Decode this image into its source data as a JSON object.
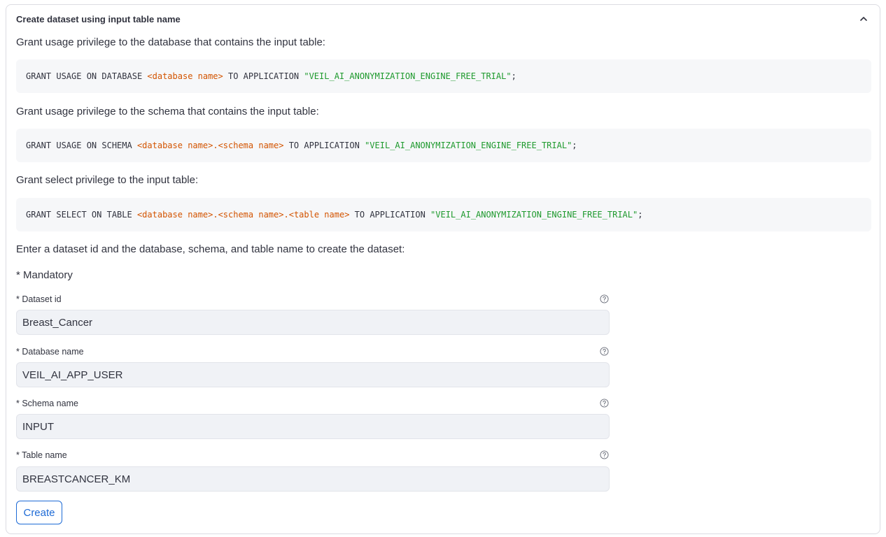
{
  "expander": {
    "title": "Create dataset using input table name"
  },
  "instructions": [
    "Grant usage privilege to the database that contains the input table:",
    "Grant usage privilege to the schema that contains the input table:",
    "Grant select privilege to the input table:",
    "Enter a dataset id and the database, schema, and table name to create the dataset:"
  ],
  "code": {
    "db": {
      "prefix": "GRANT USAGE ON DATABASE ",
      "db_placeholder": "<database name>",
      "middle": " TO APPLICATION ",
      "app": "\"VEIL_AI_ANONYMIZATION_ENGINE_FREE_TRIAL\"",
      "end": ";"
    },
    "schema": {
      "prefix": "GRANT USAGE ON SCHEMA ",
      "db_placeholder": "<database name>",
      "dot": ".",
      "schema_placeholder": "<schema name>",
      "middle": " TO APPLICATION ",
      "app": "\"VEIL_AI_ANONYMIZATION_ENGINE_FREE_TRIAL\"",
      "end": ";"
    },
    "table": {
      "prefix": "GRANT SELECT ON TABLE ",
      "db_placeholder": "<database name>",
      "dot1": ".",
      "schema_placeholder": "<schema name>",
      "dot2": ".",
      "table_placeholder": "<table name>",
      "middle": " TO APPLICATION ",
      "app": "\"VEIL_AI_ANONYMIZATION_ENGINE_FREE_TRIAL\"",
      "end": ";"
    }
  },
  "form": {
    "mandatory_note": "* Mandatory",
    "fields": [
      {
        "label": "* Dataset id",
        "value": "Breast_Cancer"
      },
      {
        "label": "* Database name",
        "value": "VEIL_AI_APP_USER"
      },
      {
        "label": "* Schema name",
        "value": "INPUT"
      },
      {
        "label": "* Table name",
        "value": "BREASTCANCER_KM"
      }
    ],
    "submit_label": "Create"
  },
  "icons": {
    "collapse": "chevron-up-icon",
    "help": "question-circle-icon"
  },
  "colors": {
    "accent": "#1e6bd6",
    "code_placeholder": "#d35400",
    "code_string": "#1f9a2e"
  }
}
